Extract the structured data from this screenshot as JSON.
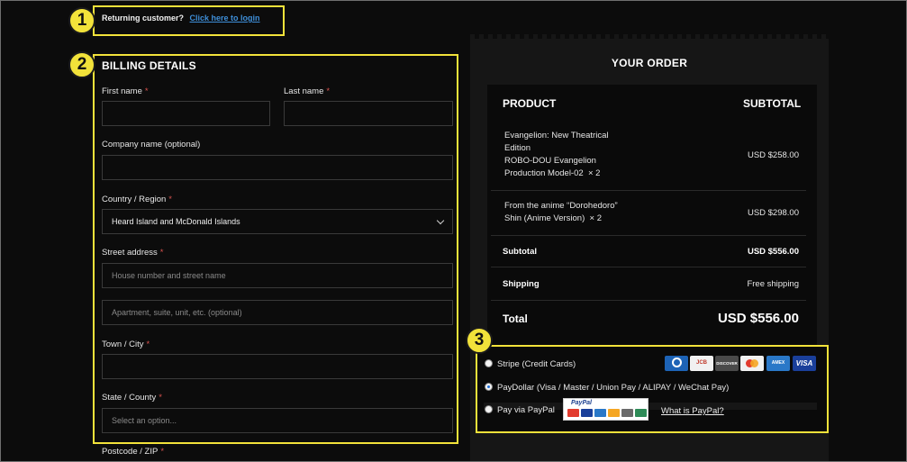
{
  "returning": {
    "text": "Returning customer?",
    "link": "Click here to login"
  },
  "badges": [
    "1",
    "2",
    "3"
  ],
  "billing": {
    "title": "BILLING DETAILS",
    "required_mark": "*",
    "first_name": {
      "label": "First name",
      "value": ""
    },
    "last_name": {
      "label": "Last name",
      "value": ""
    },
    "company": {
      "label": "Company name (optional)",
      "value": ""
    },
    "country": {
      "label": "Country / Region",
      "value": "Heard Island and McDonald Islands"
    },
    "street": {
      "label": "Street address",
      "placeholder1": "House number and street name",
      "placeholder2": "Apartment, suite, unit, etc. (optional)"
    },
    "city": {
      "label": "Town / City",
      "value": ""
    },
    "state": {
      "label": "State / County",
      "placeholder": "Select an option..."
    },
    "postcode": {
      "label": "Postcode / ZIP"
    }
  },
  "order": {
    "title": "YOUR ORDER",
    "col_product": "PRODUCT",
    "col_subtotal": "SUBTOTAL",
    "items": [
      {
        "lines": [
          "Evangelion: New Theatrical",
          "Edition",
          "ROBO-DOU Evangelion",
          "Production Model-02"
        ],
        "qty": "× 2",
        "subtotal": "USD $258.00"
      },
      {
        "lines": [
          "From the anime “Dorohedoro”",
          "Shin (Anime Version)"
        ],
        "qty": "× 2",
        "subtotal": "USD $298.00"
      }
    ],
    "subtotal_label": "Subtotal",
    "subtotal_value": "USD $556.00",
    "shipping_label": "Shipping",
    "shipping_value": "Free shipping",
    "total_label": "Total",
    "total_value": "USD $556.00"
  },
  "payment": {
    "stripe": "Stripe (Credit Cards)",
    "paydollar": "PayDollar (Visa / Master / Union Pay / ALIPAY / WeChat Pay)",
    "paypal": "Pay via PayPal",
    "paypal_logo": "PayPal",
    "what_is": "What is PayPal?",
    "selected": "paydollar",
    "cards": [
      {
        "name": "diners-icon",
        "color": "#1d63b6",
        "text": ""
      },
      {
        "name": "jcb-icon",
        "color": "#f1f1f1",
        "text": "JCB"
      },
      {
        "name": "discover-icon",
        "color": "#4a4a4a",
        "text": "DISCOVER"
      },
      {
        "name": "mastercard-icon",
        "color": "#f1f1f1",
        "text": ""
      },
      {
        "name": "amex-icon",
        "color": "#2a78c8",
        "text": "AMEX"
      },
      {
        "name": "visa-icon",
        "color": "#1a3f9a",
        "text": "VISA"
      }
    ]
  },
  "colors": {
    "highlight": "#f2e23a",
    "link": "#3e8ed8",
    "required": "#d9534f",
    "panel": "#161616"
  }
}
